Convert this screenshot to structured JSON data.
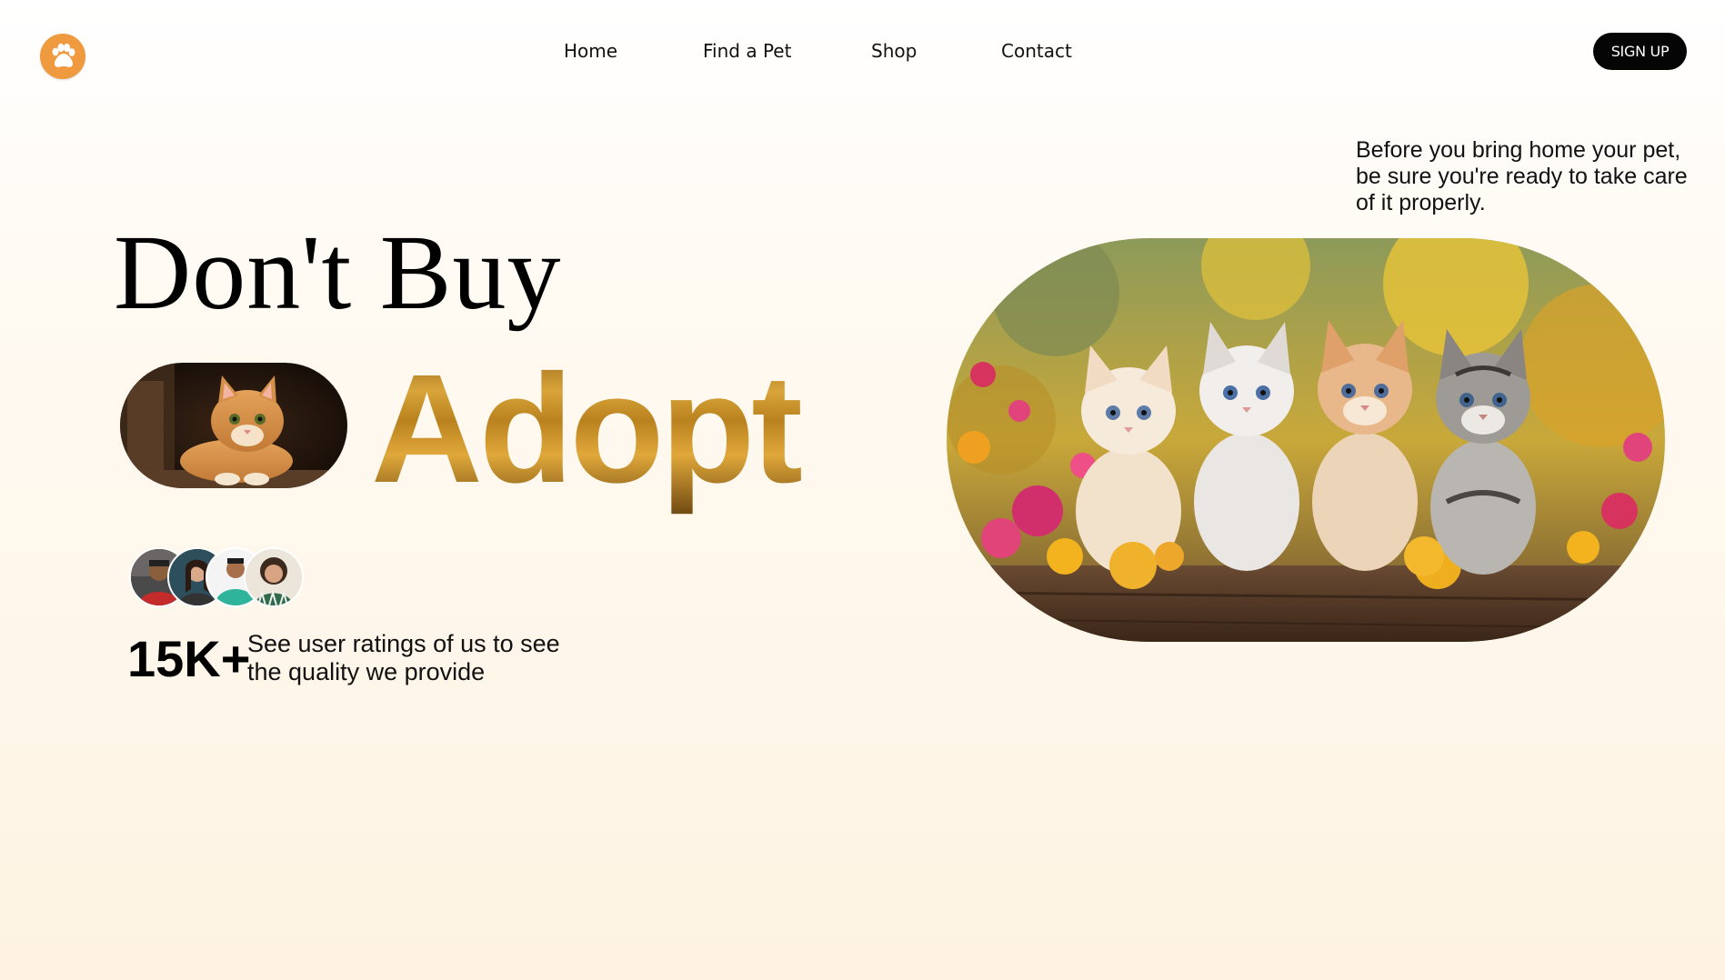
{
  "header": {
    "logo_icon": "paw-icon",
    "nav": {
      "home": "Home",
      "find_pet": "Find a Pet",
      "shop": "Shop",
      "contact": "Contact"
    },
    "signup_label": "SIGN UP"
  },
  "hero": {
    "intro": "Before you bring home your pet, be sure you're ready to take care of it properly.",
    "headline_line1": "Don't Buy",
    "headline_word2": "Adopt",
    "kitten_image_icon": "kitten-photo",
    "main_image_icon": "four-kittens-photo"
  },
  "ratings": {
    "count": "15K+",
    "text": "See user ratings of us to see the quality we provide",
    "avatar_icons": [
      "user-avatar",
      "user-avatar",
      "user-avatar",
      "user-avatar"
    ]
  },
  "colors": {
    "accent": "#ef9a3e",
    "button_bg": "#050505",
    "background_bottom": "#fef3e2"
  }
}
